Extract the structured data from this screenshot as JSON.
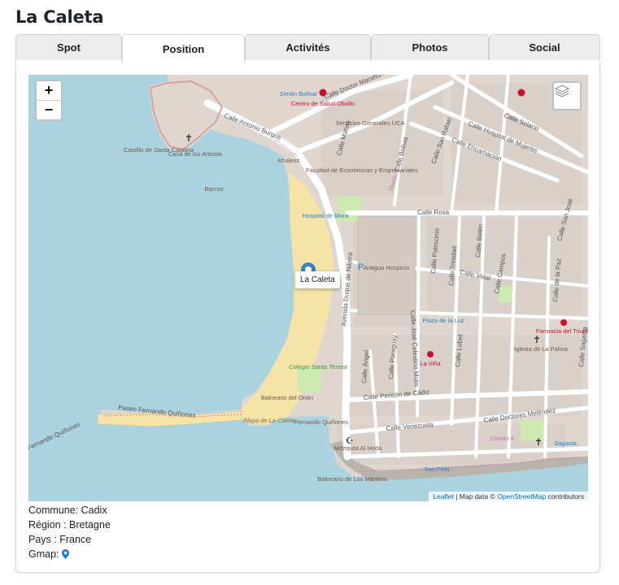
{
  "page": {
    "title": "La Caleta"
  },
  "tabs": [
    {
      "label": "Spot",
      "active": false
    },
    {
      "label": "Position",
      "active": true
    },
    {
      "label": "Activités",
      "active": false
    },
    {
      "label": "Photos",
      "active": false
    },
    {
      "label": "Social",
      "active": false
    }
  ],
  "map": {
    "zoom_in": "+",
    "zoom_out": "−",
    "layers_icon": "layers-icon",
    "marker_popup": "La Caleta",
    "attribution": {
      "leaflet": "Leaflet",
      "sep": " | Map data © ",
      "osm": "OpenStreetMap",
      "suffix": " contributors"
    },
    "labels": {
      "calle_antonio_burgos": "Calle Antonio Burgos",
      "calle_doctor_maranon": "Calle Doctor Marañón",
      "calle_solano": "Calle Solano",
      "calle_hospital_mujeres": "Calle Hospital de Mujeres",
      "calle_encarnacion": "Calle Encarnación",
      "calle_san_rafael": "Calle San Rafael",
      "calle_bolivia": "Calle Bolivia",
      "calle_matias": "Calle Matías",
      "calle_rosa": "Calle Rosa",
      "calle_san_jose": "Calle San José",
      "calle_patrocinio": "Calle Patrocinio",
      "calle_jose_celestino_mutis": "Calle José Celestino Mutis",
      "calle_trinidad": "Calle Trinidad",
      "calle_belen": "Calle Belén",
      "calle_vidal": "Calle Vidal",
      "calle_campos": "Calle Campos",
      "calle_de_la_paz": "Calle de la Paz",
      "calle_sagasta_v": "Calle Sagasta",
      "calle_angel": "Calle Ángel",
      "calle_paraguay": "Calle Paraguay",
      "calle_lubet": "Calle Lubet",
      "calle_pericon": "Calle Pericón de Cádiz",
      "calle_venezuela": "Calle Venezuela",
      "calle_doctores_melendez": "Calle Doctores Meléndez",
      "avenida_duque": "Avenida Duque de Nájera",
      "paseo_fernando": "Paseo Fernando Quiñones",
      "fernando_quinones_w": "Fernando Quiñones",
      "castillo": "Castillo de Santa Catalina",
      "casa_artistas": "Casa de los Artistas",
      "barcos": "Barcos",
      "khaless": "Khaless",
      "simon_bolivar": "Simón Bolívar",
      "centro_salud": "Centro de Salud Olivillo",
      "servicios": "Servicios Generales UCA",
      "facultad": "Facultad de Económicas y Empresariales",
      "distrito_5": "Distrito 5",
      "hospital_mora": "Hospital de Mora",
      "antiguo_hospicio": "Antiguo Hospicio",
      "plaza_luz": "Plaza de la Luz",
      "farmacia_triunfo": "Farmacia del Triunfo",
      "iglesia_palma": "Iglesia de La Palma",
      "la_vina": "La Viña",
      "colegio": "Colegio Santa Teresa",
      "balneario_orion": "Balneario del Orión",
      "playa_caleta": "Playa de La Caleta",
      "fernando_q_pub": "Fernando Quiñones",
      "mezquita": "Mezquita Al Hoda",
      "balneario_martires": "Balneario de Los Mártires",
      "san_felix": "San Félix",
      "distrito_4": "Distrito 4",
      "sagasta": "Sagasta"
    }
  },
  "info": {
    "commune_label": "Commune:",
    "commune_value": "Cadix",
    "region_label": "Région :",
    "region_value": "Bretagne",
    "pays_label": "Pays :",
    "pays_value": "France",
    "gmap_label": "Gmap:",
    "gmap_icon": "map-pin-icon"
  },
  "colors": {
    "sea": "#aad3df",
    "land": "#ded6cf",
    "beach": "#f5e3a8",
    "road": "#ffffff",
    "accent": "#1f7ae0",
    "park": "#cdebb0"
  }
}
